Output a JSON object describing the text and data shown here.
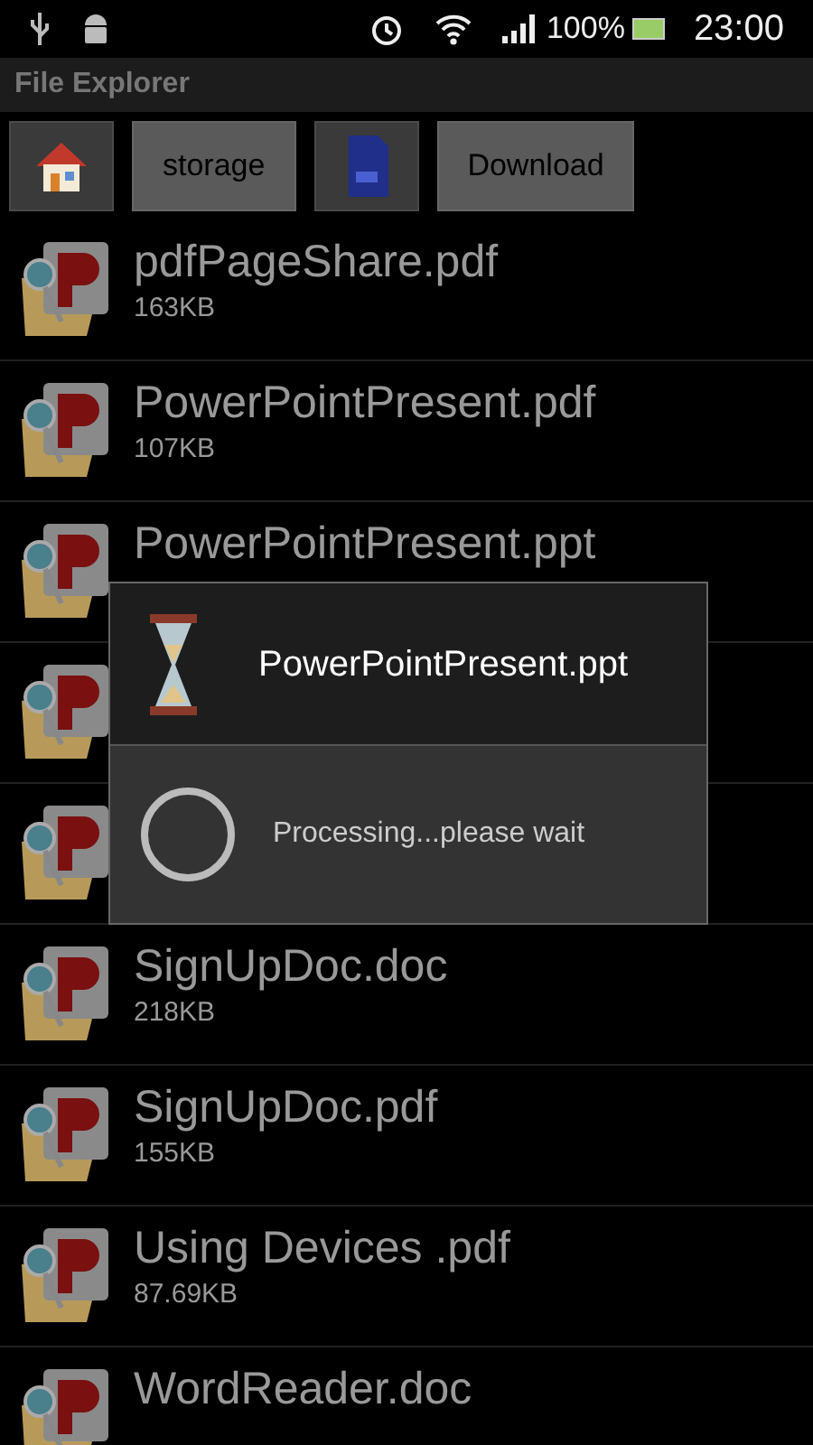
{
  "status_bar": {
    "battery": "100%",
    "time": "23:00"
  },
  "app_bar": {
    "title": "File Explorer"
  },
  "toolbar": [
    {
      "kind": "home"
    },
    {
      "kind": "text",
      "label": "storage"
    },
    {
      "kind": "sdcard"
    },
    {
      "kind": "text",
      "label": "Download"
    }
  ],
  "files": [
    {
      "kind": "file",
      "name": "pdfPageShare.pdf",
      "size": "163KB"
    },
    {
      "kind": "file",
      "name": "PowerPointPresent.pdf",
      "size": "107KB"
    },
    {
      "kind": "file",
      "name": "PowerPointPresent.ppt"
    },
    {
      "kind": "covered"
    },
    {
      "kind": "covered"
    },
    {
      "kind": "file",
      "name": "SignUpDoc.doc",
      "size": "218KB"
    },
    {
      "kind": "file",
      "name": "SignUpDoc.pdf",
      "size": "155KB"
    },
    {
      "kind": "file",
      "name": "Using Devices .pdf",
      "size": "87.69KB"
    },
    {
      "kind": "file",
      "name": "WordReader.doc"
    }
  ],
  "dialog": {
    "title": "PowerPointPresent.ppt",
    "message": "Processing...please wait"
  }
}
